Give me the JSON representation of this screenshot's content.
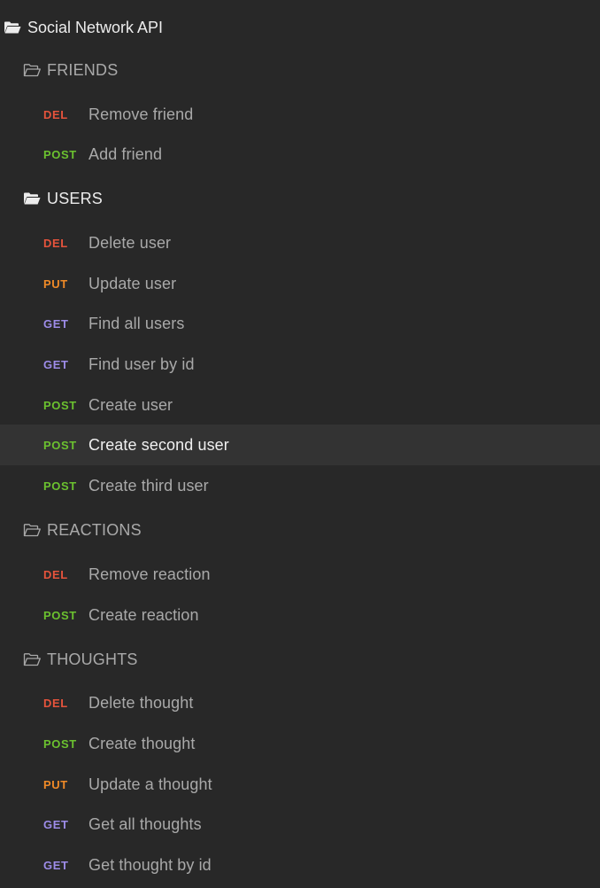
{
  "collection": {
    "title": "Social Network API",
    "folders": [
      {
        "name": "FRIENDS",
        "open": false,
        "requests": [
          {
            "method": "DEL",
            "label": "Remove friend"
          },
          {
            "method": "POST",
            "label": "Add friend"
          }
        ]
      },
      {
        "name": "USERS",
        "open": true,
        "requests": [
          {
            "method": "DEL",
            "label": "Delete user"
          },
          {
            "method": "PUT",
            "label": "Update user"
          },
          {
            "method": "GET",
            "label": "Find all users"
          },
          {
            "method": "GET",
            "label": "Find user by id"
          },
          {
            "method": "POST",
            "label": "Create user"
          },
          {
            "method": "POST",
            "label": "Create second user",
            "selected": true
          },
          {
            "method": "POST",
            "label": "Create third user"
          }
        ]
      },
      {
        "name": "REACTIONS",
        "open": false,
        "requests": [
          {
            "method": "DEL",
            "label": "Remove reaction"
          },
          {
            "method": "POST",
            "label": "Create reaction"
          }
        ]
      },
      {
        "name": "THOUGHTS",
        "open": false,
        "requests": [
          {
            "method": "DEL",
            "label": "Delete thought"
          },
          {
            "method": "POST",
            "label": "Create thought"
          },
          {
            "method": "PUT",
            "label": "Update a thought"
          },
          {
            "method": "GET",
            "label": "Get all thoughts"
          },
          {
            "method": "GET",
            "label": "Get thought by id"
          }
        ]
      }
    ]
  },
  "colors": {
    "background": "#282828",
    "selected_row": "#333333",
    "DEL": "#e5533c",
    "POST": "#6bc12f",
    "PUT": "#ef8a27",
    "GET": "#9d8ce8"
  },
  "icons": {
    "open_folder": "folder-open-icon",
    "closed_folder": "folder-outline-icon"
  }
}
